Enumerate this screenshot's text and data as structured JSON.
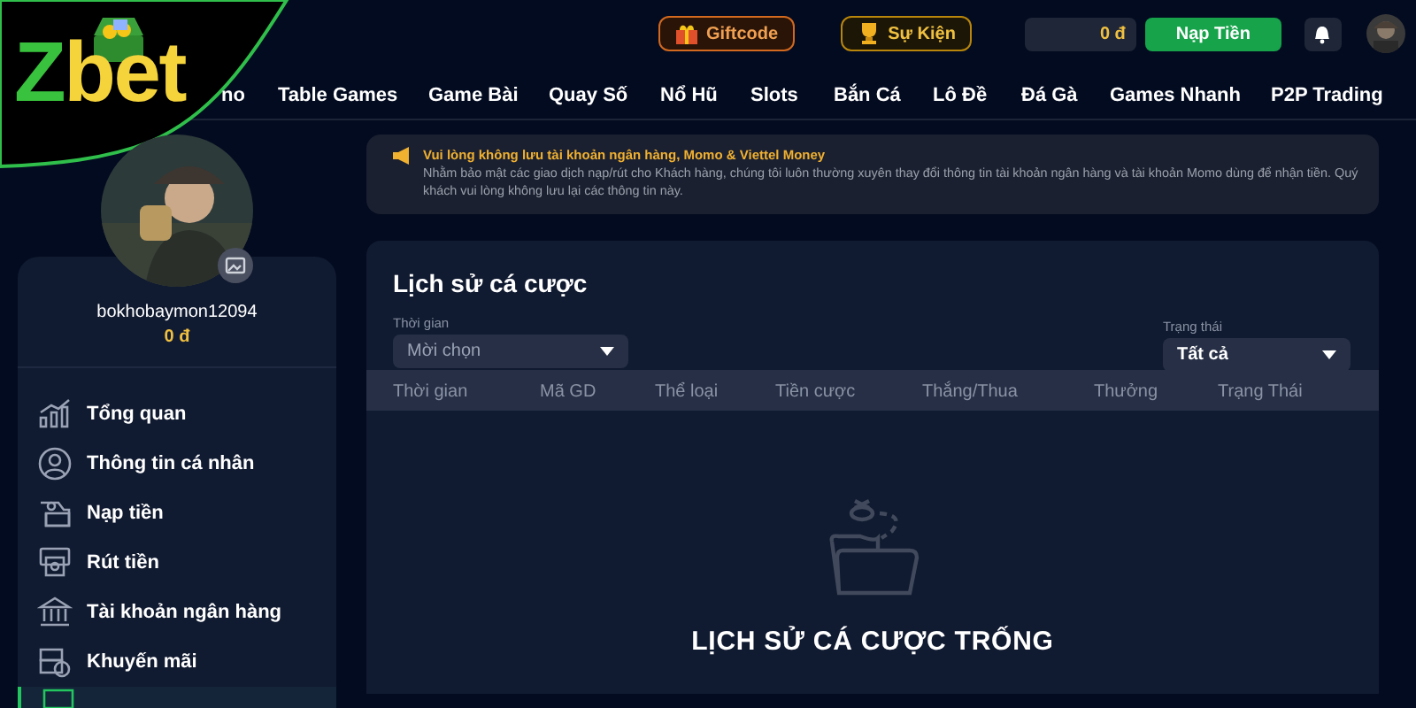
{
  "logo": "Zbet",
  "header": {
    "giftcode": "Giftcode",
    "event": "Sự Kiện",
    "balance": "0 đ",
    "deposit": "Nạp Tiền"
  },
  "nav": [
    "no",
    "Table Games",
    "Game Bài",
    "Quay Số",
    "Nổ Hũ",
    "Slots",
    "Bắn Cá",
    "Lô Đề",
    "Đá Gà",
    "Games Nhanh",
    "P2P Trading"
  ],
  "profile": {
    "username": "bokhobaymon12094",
    "balance": "0 đ"
  },
  "sidebar": {
    "items": [
      {
        "label": "Tổng quan",
        "selected": false
      },
      {
        "label": "Thông tin cá nhân",
        "selected": false
      },
      {
        "label": "Nạp tiền",
        "selected": false
      },
      {
        "label": "Rút tiền",
        "selected": false
      },
      {
        "label": "Tài khoản ngân hàng",
        "selected": false
      },
      {
        "label": "Khuyến mãi",
        "selected": false
      },
      {
        "selected": true
      }
    ]
  },
  "notice": {
    "title": "Vui lòng không lưu tài khoản ngân hàng, Momo & Viettel Money",
    "body": "Nhằm bảo mật các giao dịch nạp/rút cho Khách hàng, chúng tôi luôn thường xuyên thay đổi thông tin tài khoản ngân hàng và tài khoản Momo dùng để nhận tiền. Quý khách vui lòng không lưu lại các thông tin này."
  },
  "history": {
    "title": "Lịch sử cá cược",
    "filters": [
      {
        "label": "Thời gian",
        "value": "Mời chọn",
        "placeholder": true
      },
      {
        "label": "Trạng thái",
        "value": "Tất cả",
        "placeholder": false
      }
    ],
    "columns": [
      "Thời gian",
      "Mã GD",
      "Thể loại",
      "Tiền cược",
      "Thắng/Thua",
      "Thưởng",
      "Trạng Thái"
    ],
    "empty": "LỊCH SỬ CÁ CƯỢC TRỐNG"
  }
}
